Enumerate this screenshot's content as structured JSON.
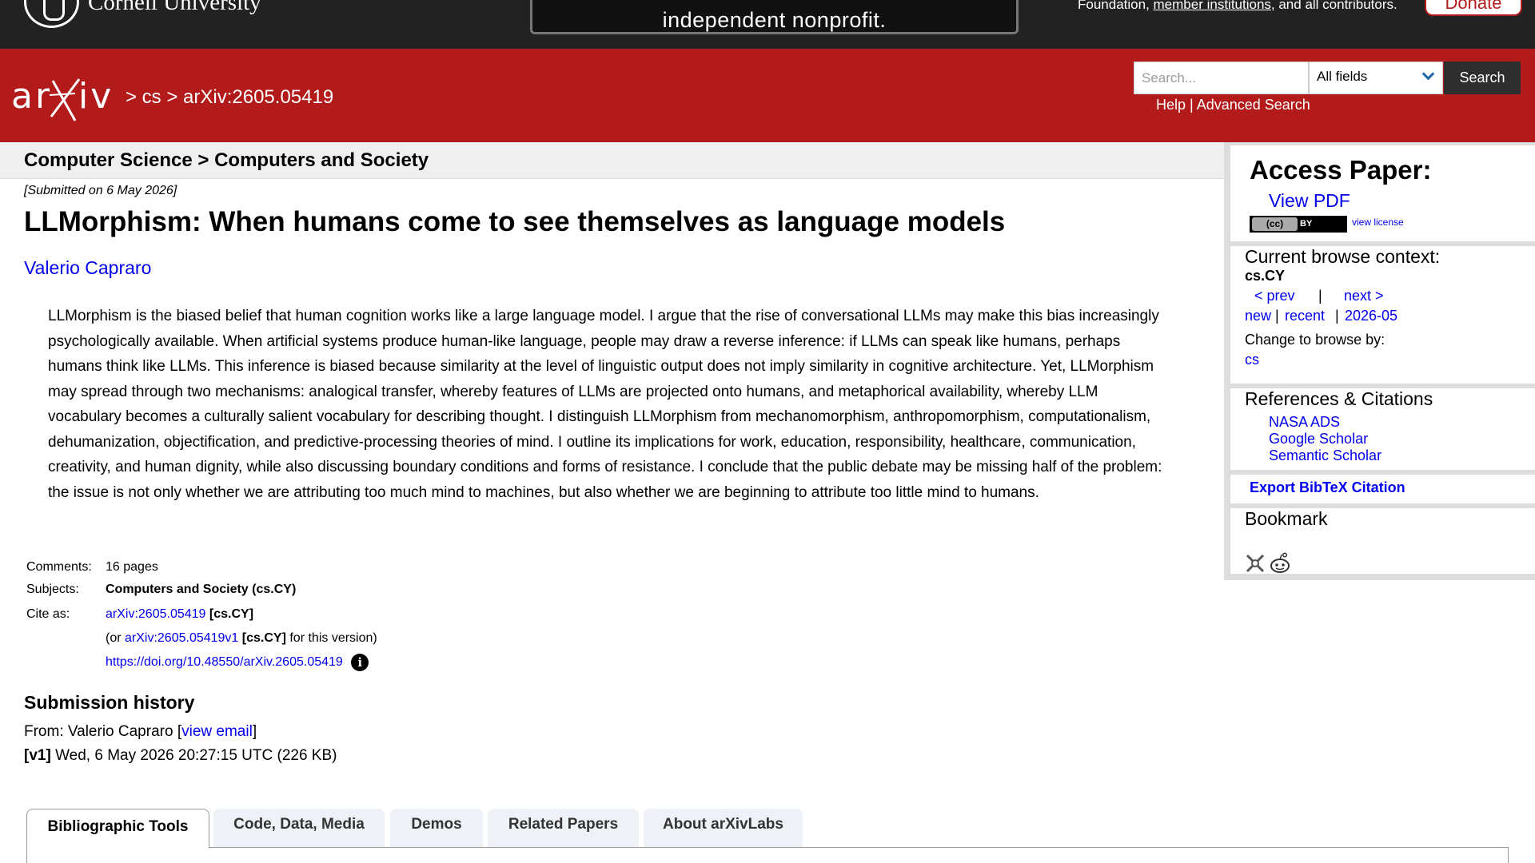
{
  "top_banner": {
    "institution": "Cornell University",
    "notice": "independent nonprofit.",
    "support_prefix": "Foundation, ",
    "support_link": "member institutions",
    "support_suffix": ", and all contributors.",
    "donate_label": "Donate"
  },
  "header": {
    "breadcrumb": "> cs > arXiv:2605.05419",
    "search_placeholder": "Search...",
    "search_field": "All fields",
    "search_button": "Search",
    "help_link": "Help",
    "separator": " | ",
    "advanced_link": "Advanced Search"
  },
  "subject_header": "Computer Science > Computers and Society",
  "paper": {
    "submitted": "[Submitted on 6 May 2026]",
    "title": "LLMorphism: When humans come to see themselves as language models",
    "author": "Valerio Capraro",
    "abstract": "LLMorphism is the biased belief that human cognition works like a large language model. I argue that the rise of conversational LLMs may make this bias increasingly psychologically available. When artificial systems produce human-like language, people may draw a reverse inference: if LLMs can speak like humans, perhaps humans think like LLMs. This inference is biased because similarity at the level of linguistic output does not imply similarity in cognitive architecture. Yet, LLMorphism may spread through two mechanisms: analogical transfer, whereby features of LLMs are projected onto humans, and metaphorical availability, whereby LLM vocabulary becomes a culturally salient vocabulary for describing thought. I distinguish LLMorphism from mechanomorphism, anthropomorphism, computationalism, dehumanization, objectification, and predictive-processing theories of mind. I outline its implications for work, education, responsibility, healthcare, communication, creativity, and human dignity, while also discussing boundary conditions and forms of resistance. I conclude that the public debate may be missing half of the problem: the issue is not only whether we are attributing too much mind to machines, but also whether we are beginning to attribute too little mind to humans."
  },
  "metadata": {
    "comments_label": "Comments:",
    "comments_value": "16 pages",
    "subjects_label": "Subjects:",
    "subjects_value": "Computers and Society (cs.CY)",
    "cite_label": "Cite as:",
    "cite_id": "arXiv:2605.05419",
    "cite_cat": "[cs.CY]",
    "version_prefix": "(or ",
    "version_id": "arXiv:2605.05419v1",
    "version_cat": "[cs.CY]",
    "version_suffix": " for this version)",
    "doi": "https://doi.org/10.48550/arXiv.2605.05419",
    "info_glyph": "i"
  },
  "history": {
    "title": "Submission history",
    "from_prefix": "From: Valerio Capraro [",
    "view_email": "view email",
    "from_suffix": "]",
    "version_tag": "[v1]",
    "version_date": " Wed, 6 May 2026 20:27:15 UTC (226 KB)"
  },
  "tabs": [
    {
      "label": "Bibliographic Tools",
      "active": true
    },
    {
      "label": "Code, Data, Media",
      "active": false
    },
    {
      "label": "Demos",
      "active": false
    },
    {
      "label": "Related Papers",
      "active": false
    },
    {
      "label": "About arXivLabs",
      "active": false
    }
  ],
  "sidebar": {
    "access_title": "Access Paper:",
    "view_pdf": "View PDF",
    "license_cc": "(cc)",
    "license_by": "BY",
    "view_license": "view license",
    "context_title": "Current browse context:",
    "context_value": "cs.CY",
    "prev": "< prev",
    "nav_sep": "|",
    "next": "next >",
    "new": "new",
    "recent": "recent",
    "month": "2026-05",
    "change_label": "Change to browse by:",
    "change_link": "cs",
    "refs_title": "References & Citations",
    "refs": [
      "NASA ADS",
      "Google Scholar",
      "Semantic Scholar"
    ],
    "export": "Export BibTeX Citation",
    "bookmark_title": "Bookmark"
  },
  "colors": {
    "arxiv_red": "#b31b1b",
    "link_blue": "#0000ee",
    "topbar": "#222222"
  }
}
